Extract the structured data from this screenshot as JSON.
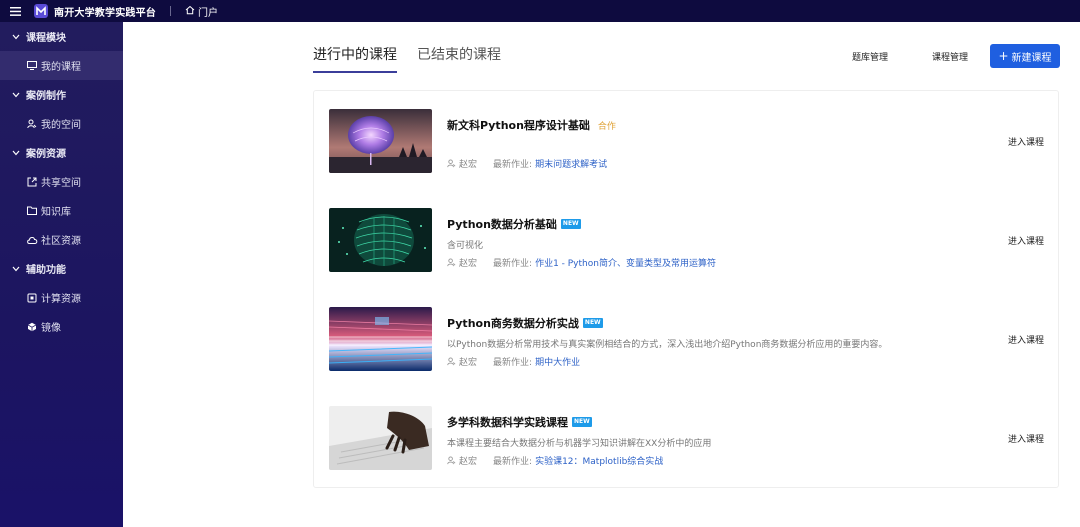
{
  "topbar": {
    "menu_icon": "menu-icon",
    "title": "南开大学教学实践平台",
    "portal_label": "门户"
  },
  "sidebar": {
    "sections": [
      {
        "label": "课程模块",
        "items": [
          {
            "label": "我的课程",
            "icon": "monitor-icon",
            "active": true
          }
        ]
      },
      {
        "label": "案例制作",
        "items": [
          {
            "label": "我的空间",
            "icon": "user-icon"
          }
        ]
      },
      {
        "label": "案例资源",
        "items": [
          {
            "label": "共享空间",
            "icon": "share-icon"
          },
          {
            "label": "知识库",
            "icon": "folder-icon"
          },
          {
            "label": "社区资源",
            "icon": "cloud-icon"
          }
        ]
      },
      {
        "label": "辅助功能",
        "items": [
          {
            "label": "计算资源",
            "icon": "compute-icon"
          },
          {
            "label": "镜像",
            "icon": "mirror-icon"
          }
        ]
      }
    ]
  },
  "tabs": [
    {
      "label": "进行中的课程",
      "active": true
    },
    {
      "label": "已结束的课程",
      "active": false
    }
  ],
  "actions": {
    "question_bank": "题库管理",
    "course_manage": "课程管理",
    "new_course": "新建课程"
  },
  "courses": [
    {
      "title": "新文科Python程序设计基础",
      "badge": "合作",
      "badge_type": "coop",
      "desc": "",
      "teacher": "赵宏",
      "latest_label": "最新作业:",
      "latest": "期末问题求解考试",
      "enter": "进入课程"
    },
    {
      "title": "Python数据分析基础",
      "badge": "NEW",
      "badge_type": "new",
      "desc": "含可视化",
      "teacher": "赵宏",
      "latest_label": "最新作业:",
      "latest": "作业1 - Python简介、变量类型及常用运算符",
      "enter": "进入课程"
    },
    {
      "title": "Python商务数据分析实战",
      "badge": "NEW",
      "badge_type": "new",
      "desc": "以Python数据分析常用技术与真实案例相结合的方式，深入浅出地介绍Python商务数据分析应用的重要内容。",
      "teacher": "赵宏",
      "latest_label": "最新作业:",
      "latest": "期中大作业",
      "enter": "进入课程"
    },
    {
      "title": "多学科数据科学实践课程",
      "badge": "NEW",
      "badge_type": "new",
      "desc": "本课程主要结合大数据分析与机器学习知识讲解在XX分析中的应用",
      "teacher": "赵宏",
      "latest_label": "最新作业:",
      "latest": "实验课12：Matplotlib综合实战",
      "enter": "进入课程"
    }
  ],
  "colors": {
    "topbar": "#0e0b3f",
    "sidebar": "#1c1560",
    "primary": "#1f5fe0",
    "link": "#2e62c7",
    "coop": "#e0a43a",
    "new_badge": "#1e9be9"
  }
}
